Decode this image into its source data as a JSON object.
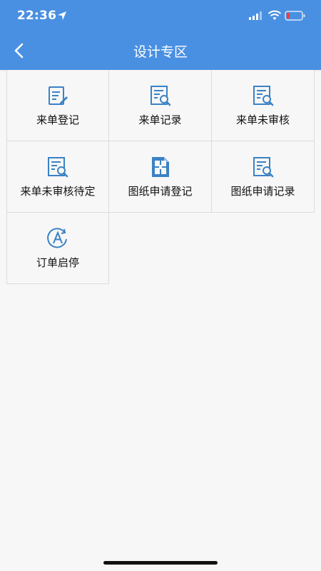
{
  "status_bar": {
    "time": "22:36"
  },
  "nav": {
    "title": "设计专区"
  },
  "colors": {
    "header": "#4a90e2",
    "icon": "#3b82c4"
  },
  "grid": {
    "items": [
      {
        "label": "来单登记",
        "icon": "form-edit-icon"
      },
      {
        "label": "来单记录",
        "icon": "document-search-icon"
      },
      {
        "label": "来单未审核",
        "icon": "document-search-icon"
      },
      {
        "label": "来单未审核待定",
        "icon": "document-search-icon"
      },
      {
        "label": "图纸申请登记",
        "icon": "blueprint-icon"
      },
      {
        "label": "图纸申请记录",
        "icon": "document-search-icon"
      },
      {
        "label": "订单启停",
        "icon": "circle-a-icon"
      }
    ]
  }
}
